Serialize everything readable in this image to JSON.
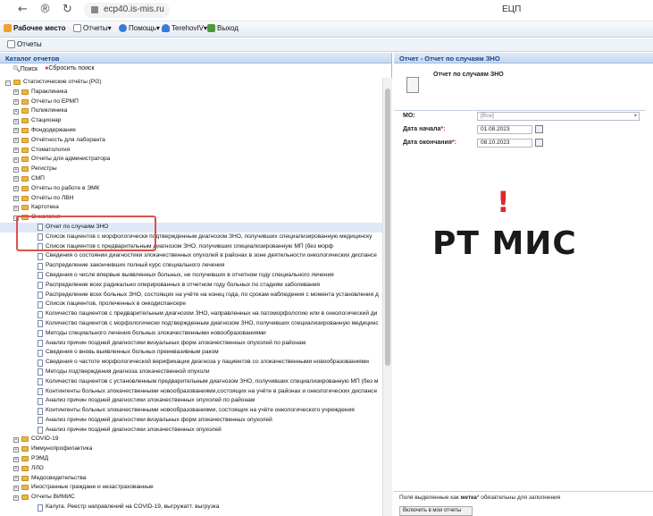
{
  "browser": {
    "url": "ecp40.is-mis.ru",
    "page_title": "ЕЦП"
  },
  "toolbar": {
    "workplace": "Рабочее место",
    "reports": "Отчеты",
    "help": "Помощь",
    "user": "TerehovIV",
    "exit": "Выход"
  },
  "tab": {
    "label": "Отчеты"
  },
  "left": {
    "header": "Каталог отчетов",
    "search": "Поиск",
    "reset": "Сбросить поиск"
  },
  "tree": [
    {
      "level": 0,
      "type": "folder",
      "label": "Статистические отчёты (PG)"
    },
    {
      "level": 1,
      "type": "folder",
      "label": "Параклиника"
    },
    {
      "level": 1,
      "type": "folder",
      "label": "Отчёты по ЕРМП"
    },
    {
      "level": 1,
      "type": "folder",
      "label": "Поликлиника"
    },
    {
      "level": 1,
      "type": "folder",
      "label": "Стационар"
    },
    {
      "level": 1,
      "type": "folder",
      "label": "Фондодержание"
    },
    {
      "level": 1,
      "type": "folder",
      "label": "Отчётность для лаборанта"
    },
    {
      "level": 1,
      "type": "folder",
      "label": "Стоматология"
    },
    {
      "level": 1,
      "type": "folder",
      "label": "Отчеты для администратора"
    },
    {
      "level": 1,
      "type": "folder",
      "label": "Регистры"
    },
    {
      "level": 1,
      "type": "folder",
      "label": "СМП"
    },
    {
      "level": 1,
      "type": "folder",
      "label": "Отчёты по работе в ЭМК"
    },
    {
      "level": 1,
      "type": "folder",
      "label": "Отчёты по ЛВН"
    },
    {
      "level": 1,
      "type": "folder",
      "label": "Картотека"
    },
    {
      "level": 1,
      "type": "folder",
      "label": "Онкология",
      "open": true
    },
    {
      "level": 2,
      "type": "doc",
      "label": "Отчет по случаям ЗНО",
      "selected": true
    },
    {
      "level": 2,
      "type": "doc",
      "label": "Список пациентов с морфологически подтвержденным диагнозом ЗНО, получивших специализированную медицинску"
    },
    {
      "level": 2,
      "type": "doc",
      "label": "Список пациентов с предварительным диагнозом ЗНО, получивших специализированную МП (без морф"
    },
    {
      "level": 2,
      "type": "doc",
      "label": "Сведения о состоянии диагностики злокачественных опухолей в районах в зоне деятельности онкологических диспансе"
    },
    {
      "level": 2,
      "type": "doc",
      "label": "Распределение закончивших полный курс специального лечения"
    },
    {
      "level": 2,
      "type": "doc",
      "label": "Сведения о числе впервые выявленных больных, не получивших в отчетном году специального лечения"
    },
    {
      "level": 2,
      "type": "doc",
      "label": "Распределение всех радикально оперированных в отчетном году больных по стадиям заболевания"
    },
    {
      "level": 2,
      "type": "doc",
      "label": "Распределение всех больных ЗНО, состоящих на учёте на конец года, по срокам наблюдения с момента установления д"
    },
    {
      "level": 2,
      "type": "doc",
      "label": "Список пациентов, пролеченных в онкодиспансере"
    },
    {
      "level": 2,
      "type": "doc",
      "label": "Количество пациентов с предварительным диагнозом ЗНО, направленных на патоморфологию или в онкологический ди"
    },
    {
      "level": 2,
      "type": "doc",
      "label": "Количество пациентов с морфологически подтвержденным диагнозом ЗНО, получивших специализированную медицинс"
    },
    {
      "level": 2,
      "type": "doc",
      "label": "Методы специального лечения больных злокачественными новообразованиями"
    },
    {
      "level": 2,
      "type": "doc",
      "label": "Анализ причин поздней диагностики визуальных форм злокачественных опухолей по районам"
    },
    {
      "level": 2,
      "type": "doc",
      "label": "Сведения о вновь выявленных больных преинвазивным раком"
    },
    {
      "level": 2,
      "type": "doc",
      "label": "Сведения о частоте морфологической верификации диагноза у пациентов со злокачественными новообразованиями"
    },
    {
      "level": 2,
      "type": "doc",
      "label": "Методы подтверждения диагноза злокачественной опухоли"
    },
    {
      "level": 2,
      "type": "doc",
      "label": "Количество пациентов с установленным предварительным диагнозом ЗНО, получивших специализированную МП (без м"
    },
    {
      "level": 2,
      "type": "doc",
      "label": "Контингенты больных злокачественными новообразованиями,состоящих на учёте в районах и онкологических диспансе"
    },
    {
      "level": 2,
      "type": "doc",
      "label": "Анализ причин поздней диагностики злокачественных опухолей по районам"
    },
    {
      "level": 2,
      "type": "doc",
      "label": "Контингенты больных злокачественными новообразованиями, состоящих на учёте онкологического учреждения"
    },
    {
      "level": 2,
      "type": "doc",
      "label": "Анализ причин поздней диагностики визуальных форм злокачественных опухолей"
    },
    {
      "level": 2,
      "type": "doc",
      "label": "Анализ причин поздней диагностики злокачественных опухолей"
    },
    {
      "level": 1,
      "type": "folder",
      "label": "COVID-19"
    },
    {
      "level": 1,
      "type": "folder",
      "label": "Иммунопрофилактика"
    },
    {
      "level": 1,
      "type": "folder",
      "label": "РЭМД"
    },
    {
      "level": 1,
      "type": "folder",
      "label": "ЛЛО"
    },
    {
      "level": 1,
      "type": "folder",
      "label": "Медосвидетельства"
    },
    {
      "level": 1,
      "type": "folder",
      "label": "Иностранные граждане и незастрахованные"
    },
    {
      "level": 1,
      "type": "folder",
      "label": "Отчеты ВИМИС"
    },
    {
      "level": 2,
      "type": "doc",
      "label": "Калуга. Реестр направлений на COVID-19, выгружатт. выгрузка"
    }
  ],
  "right": {
    "header": "Отчет - Отчет по случаям ЗНО",
    "report_title": "Отчет по случаям ЗНО",
    "mo_label": "МО:",
    "mo_value": "[Все]",
    "start_label": "Дата начала",
    "start_value": "01.08.2023",
    "end_label": "Дата окончания",
    "end_value": "08.10.2023",
    "required_mark": "*:",
    "footer_prefix": "Поля выделенные как ",
    "footer_bold": "метка",
    "footer_suffix": "* обязательны для заполнения",
    "footer_button": "Включить в мои отчеты"
  },
  "overlay": {
    "exclamation": "!",
    "caption": "РТ МИС"
  },
  "colors": {
    "highlight": "#d9534f",
    "accent_red": "#d92b2b",
    "header_text": "#15428b"
  }
}
